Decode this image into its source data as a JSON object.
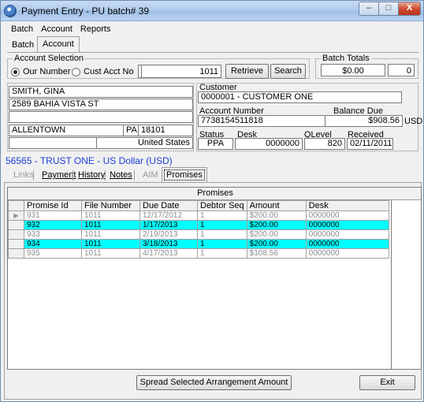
{
  "window": {
    "title": "Payment Entry - PU batch# 39",
    "minimize_glyph": "–",
    "maximize_glyph": "□",
    "close_glyph": "X"
  },
  "menu": [
    "Batch",
    "Account",
    "Reports"
  ],
  "top_tabs": {
    "batch": "Batch",
    "account": "Account"
  },
  "account_selection": {
    "label": "Account Selection",
    "our_number_label": "Our Number",
    "cust_acct_label": "Cust Acct No",
    "input_left_value": "",
    "input_value": "1011",
    "retrieve_label": "Retrieve",
    "search_label": "Search"
  },
  "batch_totals": {
    "label": "Batch Totals",
    "amount": "$0.00",
    "count": "0"
  },
  "address": {
    "name": "SMITH, GINA",
    "street": "2589 BAHIA VISTA ST",
    "line3": "",
    "city": "ALLENTOWN",
    "state": "PA",
    "zip": "18101",
    "country": "United States"
  },
  "customer_info": {
    "customer_label": "Customer",
    "customer_value": "0000001 - CUSTOMER ONE",
    "account_number_label": "Account Number",
    "account_number_value": "7738154511818",
    "balance_due_label": "Balance Due",
    "balance_due_value": "$908.56",
    "currency": "USD",
    "status_label": "Status",
    "status_value": "PPA",
    "desk_label": "Desk",
    "desk_value": "0000000",
    "qlevel_label": "QLevel",
    "qlevel_value": "820",
    "received_label": "Received",
    "received_value": "02/11/2011"
  },
  "trust_line": "56565 - TRUST ONE - US Dollar (USD)",
  "sub_tabs": {
    "links": "Links",
    "payment": "Payment",
    "history": "History",
    "notes": "Notes",
    "aim": "AIM",
    "promises": "Promises"
  },
  "promises_grid": {
    "caption": "Promises",
    "columns": [
      "Promise Id",
      "File Number",
      "Due Date",
      "Debtor Seq",
      "Amount",
      "Desk"
    ],
    "rows": [
      {
        "promise_id": "931",
        "file_number": "1011",
        "due_date": "12/17/2012",
        "debtor_seq": "1",
        "amount": "$200.00",
        "desk": "0000000",
        "style": "gray",
        "current": true
      },
      {
        "promise_id": "932",
        "file_number": "1011",
        "due_date": "1/17/2013",
        "debtor_seq": "1",
        "amount": "$200.00",
        "desk": "0000000",
        "style": "cyan",
        "current": false
      },
      {
        "promise_id": "933",
        "file_number": "1011",
        "due_date": "2/19/2013",
        "debtor_seq": "1",
        "amount": "$200.00",
        "desk": "0000000",
        "style": "gray",
        "current": false
      },
      {
        "promise_id": "934",
        "file_number": "1011",
        "due_date": "3/18/2013",
        "debtor_seq": "1",
        "amount": "$200.00",
        "desk": "0000000",
        "style": "cyan",
        "current": false
      },
      {
        "promise_id": "935",
        "file_number": "1011",
        "due_date": "4/17/2013",
        "debtor_seq": "1",
        "amount": "$108.56",
        "desk": "0000000",
        "style": "gray",
        "current": false
      }
    ],
    "current_row_marker": "▶"
  },
  "buttons": {
    "spread_label": "Spread Selected Arrangement Amount",
    "exit_label": "Exit"
  },
  "colors": {
    "highlight_row": "#00ffff",
    "trust_text": "#1a3fd6",
    "window_bg": "#f0f0f0"
  },
  "icons": {
    "app": "payment-app-icon",
    "row_pointer": "current-row-arrow-icon"
  }
}
